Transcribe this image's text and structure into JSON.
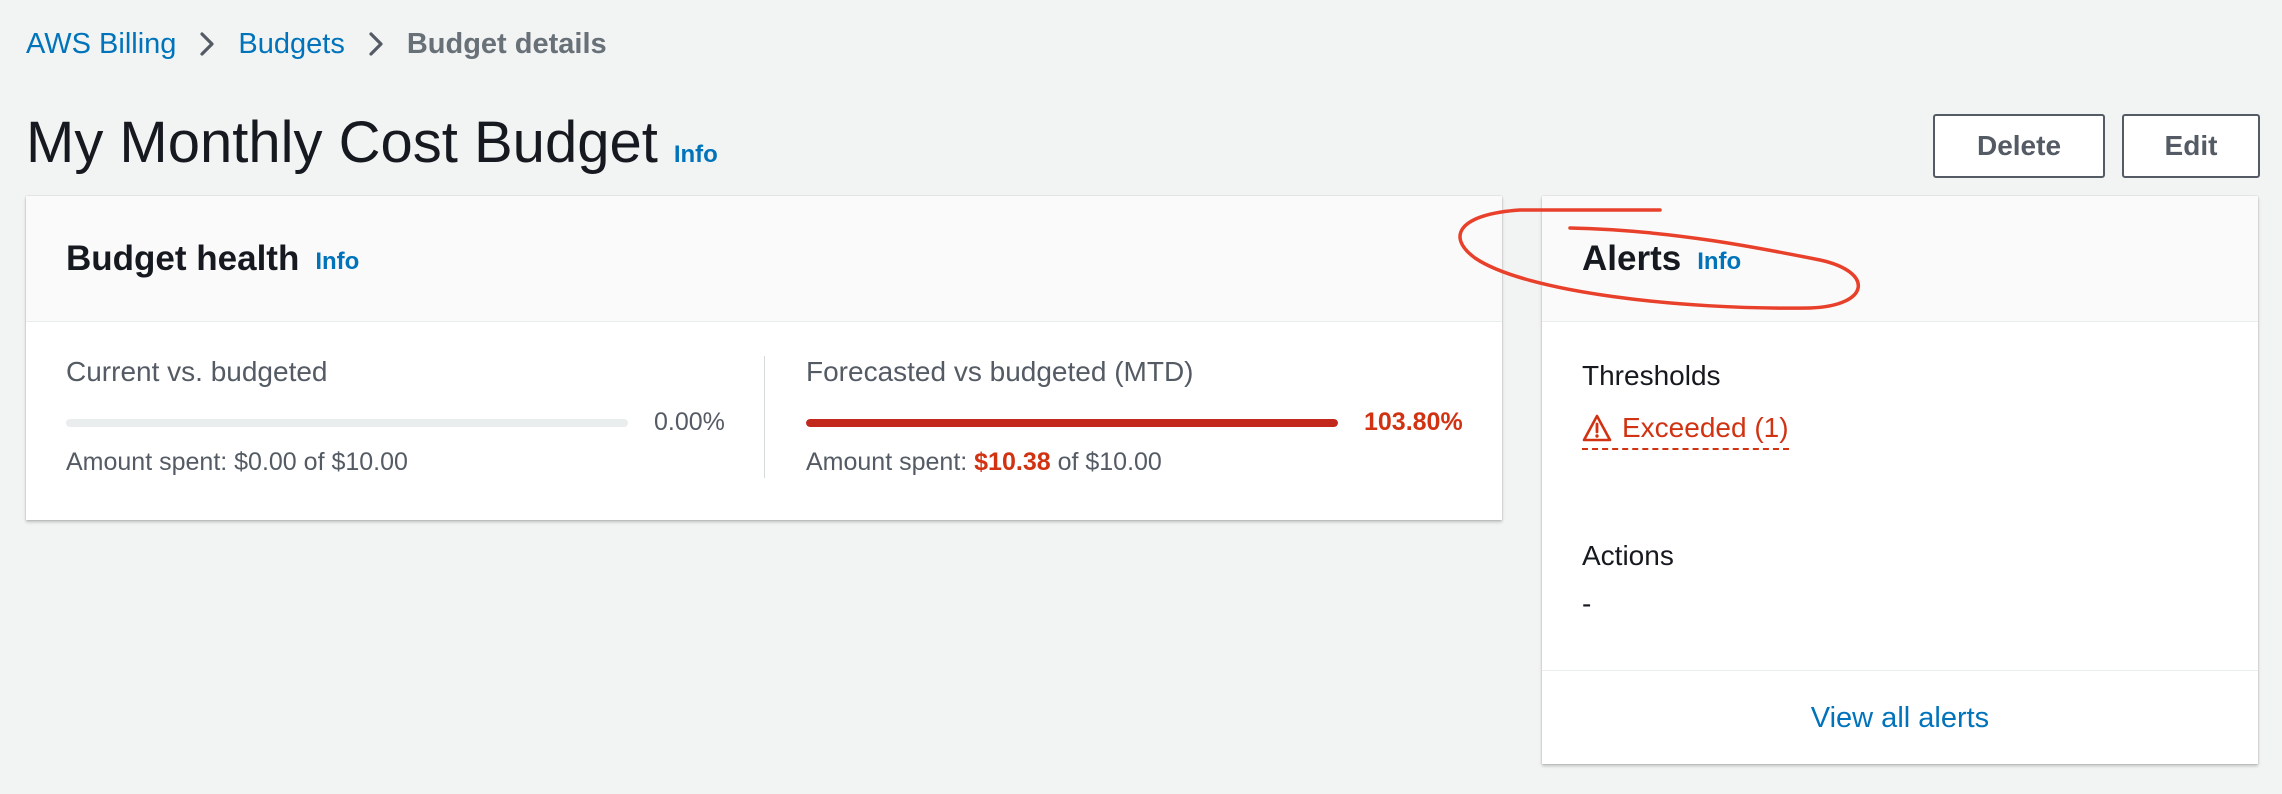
{
  "breadcrumb": {
    "items": [
      "AWS Billing",
      "Budgets"
    ],
    "current": "Budget details"
  },
  "page": {
    "title": "My Monthly Cost Budget",
    "info": "Info"
  },
  "buttons": {
    "delete": "Delete",
    "edit": "Edit"
  },
  "health": {
    "title": "Budget health",
    "info": "Info",
    "current": {
      "label": "Current vs. budgeted",
      "percent_text": "0.00%",
      "progress_fraction": 0.0,
      "amount_prefix": "Amount spent: $0.00 of $10.00"
    },
    "forecast": {
      "label": "Forecasted vs budgeted (MTD)",
      "percent_text": "103.80%",
      "progress_fraction": 1.0,
      "amount_prefix": "Amount spent: ",
      "amount_spent": "$10.38",
      "amount_suffix": " of $10.00"
    }
  },
  "alerts": {
    "title": "Alerts",
    "info": "Info",
    "thresholds_label": "Thresholds",
    "exceeded_text": "Exceeded (1)",
    "actions_label": "Actions",
    "actions_value": "-",
    "view_all": "View all alerts"
  },
  "colors": {
    "link": "#0073bb",
    "danger": "#d13212",
    "annotation": "#e8402a"
  },
  "icons": [
    "chevron-right-icon",
    "warning-triangle-icon"
  ]
}
